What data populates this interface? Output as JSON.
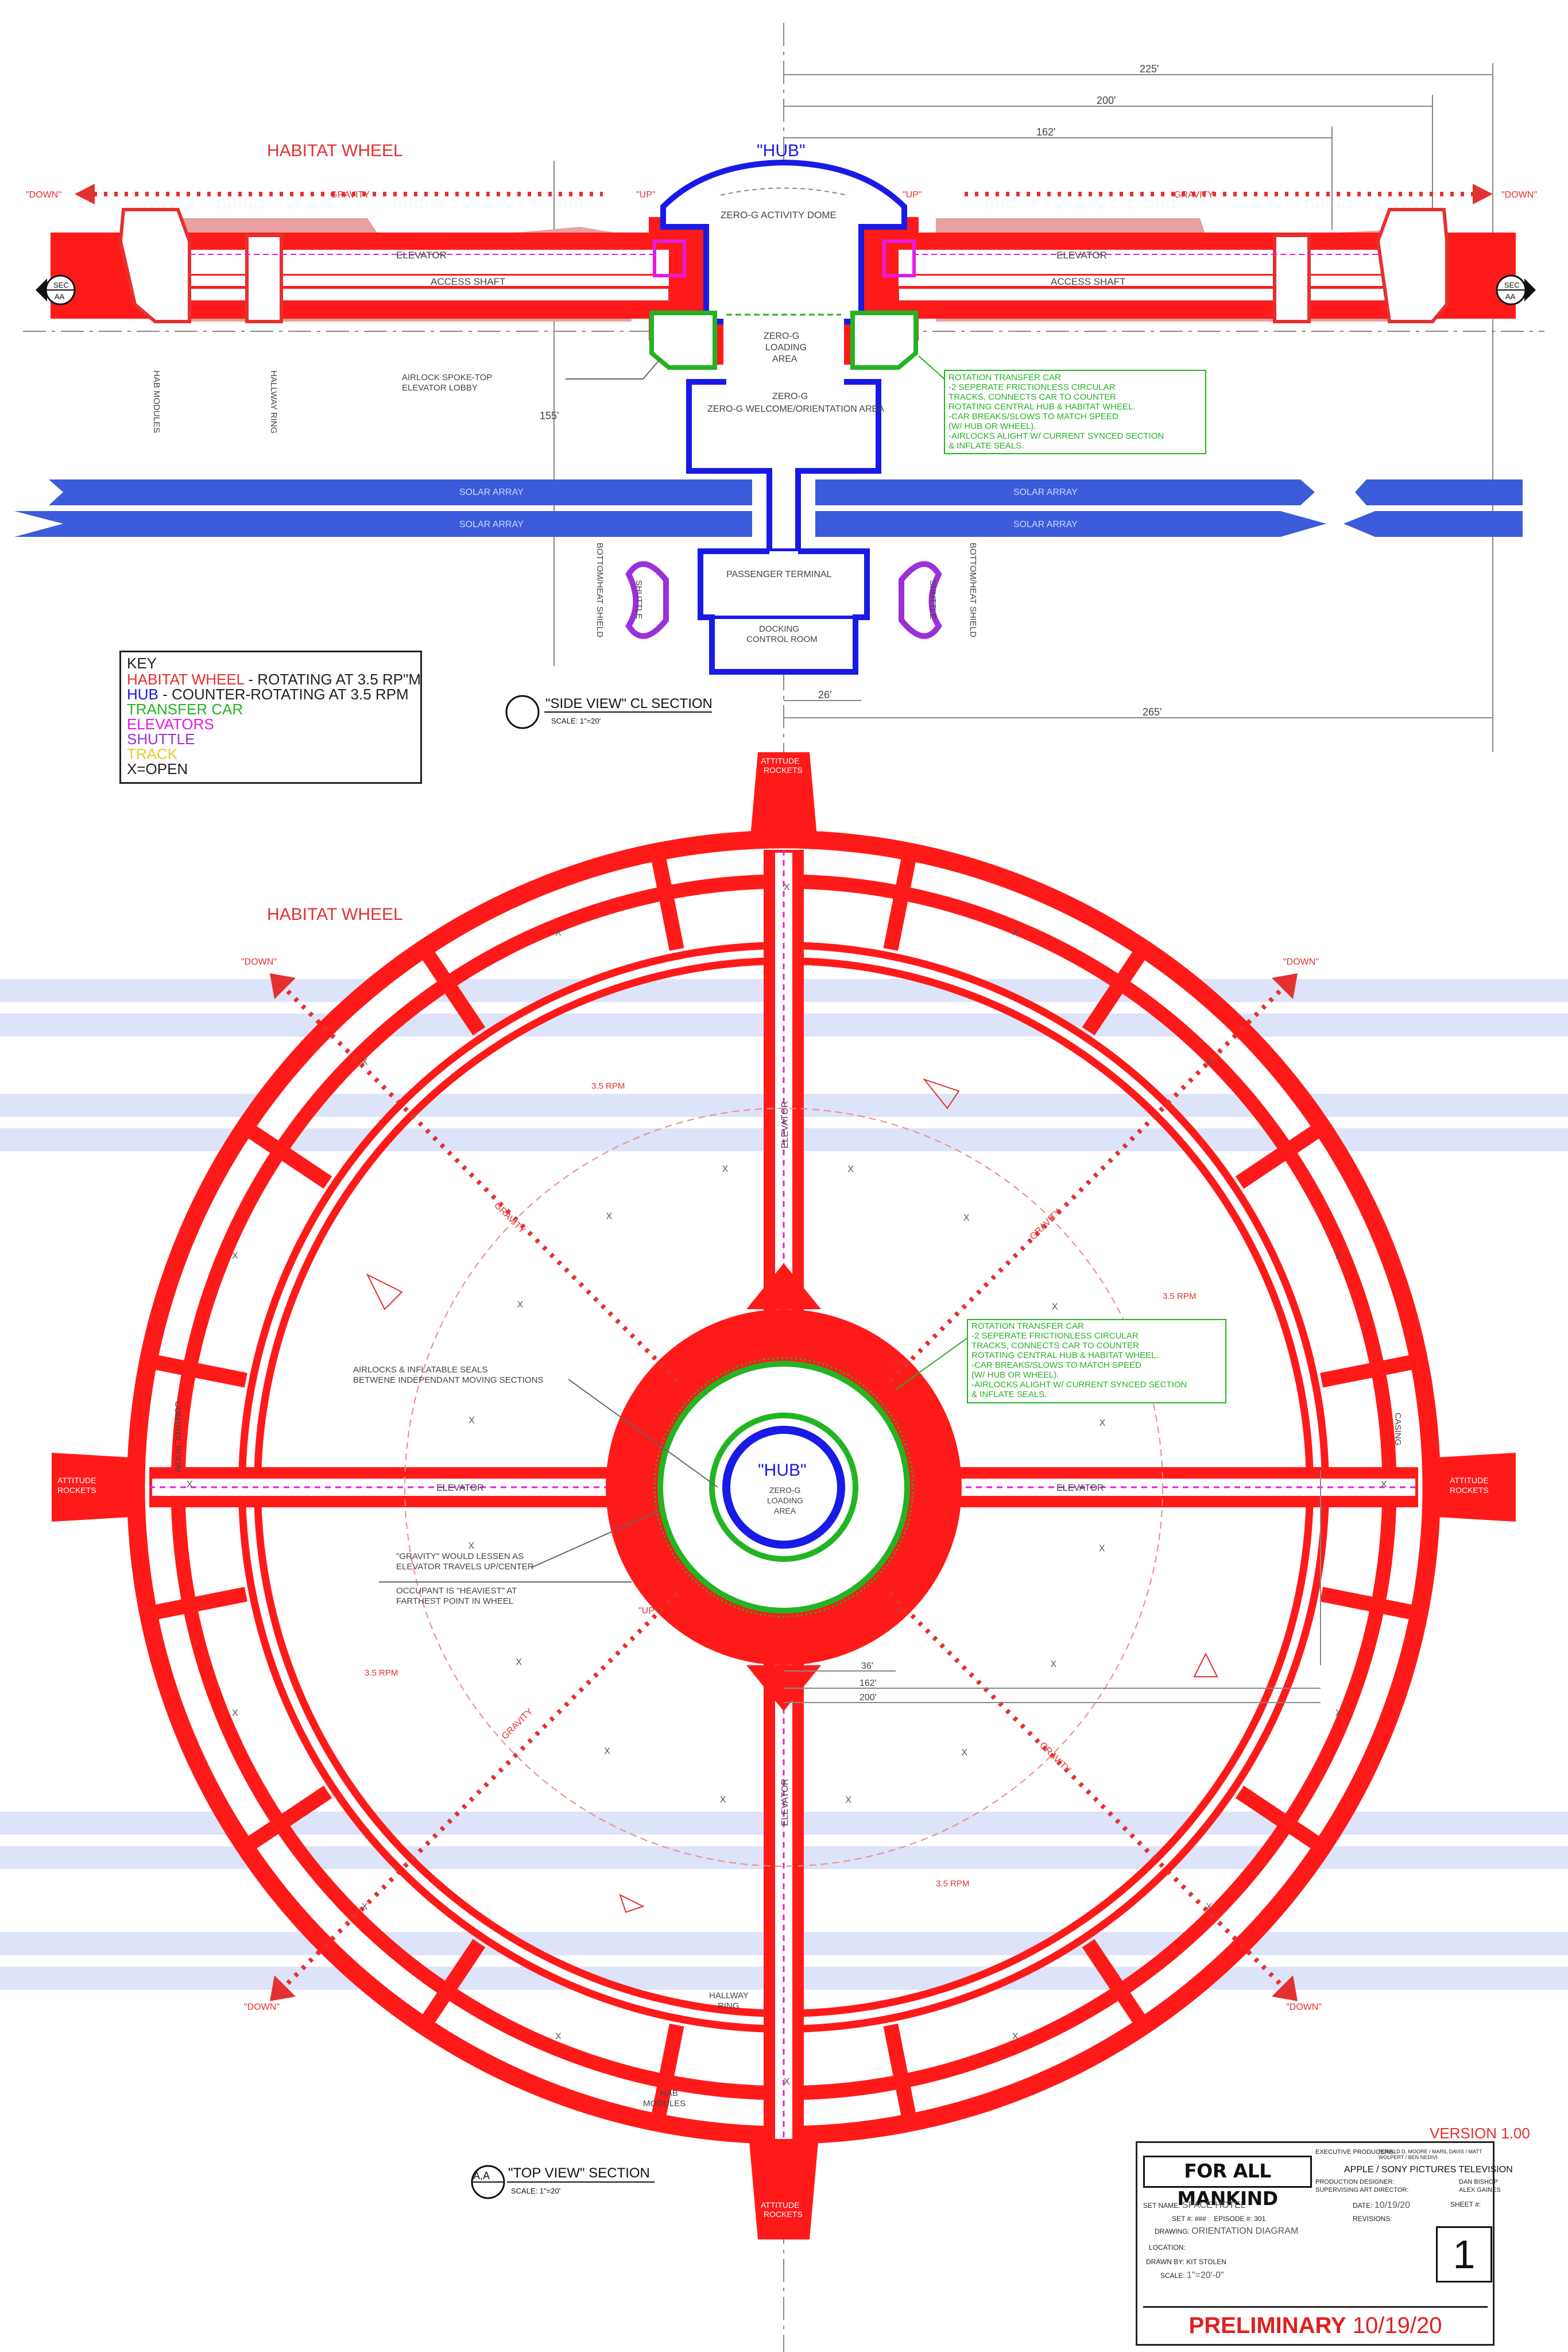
{
  "colors": {
    "habitat": "#ff1a1a",
    "hub": "#1a1ae6",
    "transfer_car": "#22b422",
    "elevators": "#e61ae6",
    "shuttle": "#9a30d8",
    "track": "#e8c830",
    "solar": "#3b5bdb",
    "faded_hab": "#e8a0a0"
  },
  "side_view": {
    "habitat_wheel_label": "HABITAT WHEEL",
    "hub_label": "\"HUB\"",
    "down_label": "\"DOWN\"",
    "up_label": "\"UP\"",
    "gravity_label": "GRAVITY",
    "elevator_label": "ELEVATOR",
    "access_shaft_label": "ACCESS SHAFT",
    "sec_label": "SEC",
    "sec_id": "AA",
    "hab_modules_label": "HAB MODULES",
    "hallway_ring_label": "HALLWAY RING",
    "zero_g_dome": "ZERO-G ACTIVITY DOME",
    "zero_g_loading": "ZERO-G LOADING AREA",
    "welcome_area": "ZERO-G WELCOME/ORIENTATION AREA",
    "airlock_lobby": "AIRLOCK SPOKE-TOP ELEVATOR LOBBY",
    "solar_array": "SOLAR ARRAY",
    "passenger_terminal": "PASSENGER TERMINAL",
    "docking_control": "DOCKING CONTROL ROOM",
    "shuttle_label": "SHUTTLE",
    "bottom_heat_shield": "BOTTOM/HEAT SHIELD",
    "section_title": "\"SIDE VIEW\" CL SECTION",
    "section_scale": "SCALE: 1\"=20'",
    "dimensions": {
      "d225": "225'",
      "d200": "200'",
      "d162": "162'",
      "d155": "155'",
      "d26": "26'",
      "d265": "265'"
    },
    "transfer_car_note": [
      "ROTATION TRANSFER CAR",
      "-2 SEPERATE FRICTIONLESS CIRCULAR",
      "TRACKS, CONNECTS CAR TO COUNTER",
      "ROTATING CENTRAL HUB & HABITAT WHEEL.",
      "-CAR BREAKS/SLOWS TO MATCH SPEED",
      "(W/ HUB OR WHEEL).",
      "-AIRLOCKS ALIGHT W/ CURRENT SYNCED SECTION",
      "& INFLATE SEALS."
    ]
  },
  "key": {
    "title": "KEY",
    "items": [
      {
        "label": "HABITAT WHEEL",
        "desc": " - ROTATING AT 3.5 RP\"M",
        "color": "#e53030"
      },
      {
        "label": "HUB",
        "desc": " - COUNTER-ROTATING AT 3.5 RPM",
        "color": "#1a1ae6"
      },
      {
        "label": "TRANSFER CAR",
        "desc": "",
        "color": "#22b422"
      },
      {
        "label": "ELEVATORS",
        "desc": "",
        "color": "#e61ae6"
      },
      {
        "label": "SHUTTLE",
        "desc": "",
        "color": "#9a30d8"
      },
      {
        "label": "TRACK",
        "desc": "",
        "color": "#e8c830"
      },
      {
        "label": "X=OPEN",
        "desc": "",
        "color": "#222222"
      }
    ]
  },
  "top_view": {
    "habitat_wheel_label": "HABITAT WHEEL",
    "attitude_rockets": "ATTITUDE ROCKETS",
    "down_label": "\"DOWN\"",
    "up_label": "\"UP\"",
    "gravity_label": "GRAVITY",
    "rpm_label": "3.5 RPM",
    "elevator_label": "ELEVATOR",
    "control_room": "CONTROL ROOM",
    "casing": "CASING",
    "open_mark": "X",
    "hub_label": "\"HUB\"",
    "zero_g_loading": "ZERO-G LOADING AREA",
    "airlocks_note": "AIRLOCKS & INFLATABLE SEALS BETWENE INDEPENDANT MOVING SECTIONS",
    "gravity_note": "\"GRAVITY\" WOULD LESSEN AS ELEVATOR TRAVELS UP/CENTER",
    "heaviest_note": "OCCUPANT IS \"HEAVIEST\" AT FARTHEST POINT IN WHEEL",
    "hallway_ring": "HALLWAY RING",
    "hab_modules": "HAB MODULES",
    "dimensions": {
      "d36": "36'",
      "d162": "162'",
      "d200": "200'"
    },
    "section_title": "\"TOP VIEW\" SECTION",
    "section_scale": "SCALE: 1\"=20'",
    "section_id": "A,A"
  },
  "title_block": {
    "version": "VERSION 1.00",
    "show": "FOR ALL MANKIND",
    "exec_producers_label": "EXECUTIVE PRODUCERS:",
    "exec_producers": "RONALD D. MOORE / MARIL DAVIS / MATT WOLPERT / BEN NEDIVI",
    "studio": "APPLE / SONY PICTURES TELEVISION",
    "production_designer_label": "PRODUCTION DESIGNER:",
    "production_designer": "DAN BISHOP",
    "supervising_ad_label": "SUPERVISING ART DIRECTOR:",
    "supervising_ad": "ALEX GAINES",
    "set_name_label": "SET NAME:",
    "set_name": "SPACE HOTEL",
    "set_no_label": "SET #:",
    "set_no": "###",
    "episode_label": "EPISODE #:",
    "episode": "301",
    "drawing_label": "DRAWING:",
    "drawing": "ORIENTATION DIAGRAM",
    "location_label": "LOCATION:",
    "drawn_by_label": "DRAWN BY:",
    "drawn_by": "KIT STOLEN",
    "scale_label": "SCALE:",
    "scale": "1\"=20'-0\"",
    "date_label": "DATE:",
    "date": "10/19/20",
    "revisions_label": "REVISIONS:",
    "sheet_label": "SHEET #:",
    "sheet": "1",
    "status": "PRELIMINARY",
    "status_date": "10/19/20"
  }
}
